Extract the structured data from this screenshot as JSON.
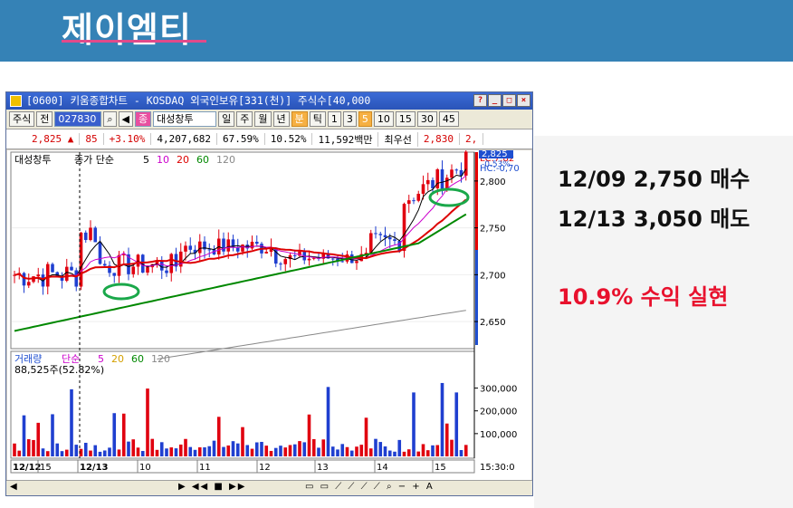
{
  "header": {
    "title": "제이엠티"
  },
  "window": {
    "title": "[0600] 키움종합차트 - KOSDAQ 외국인보유[331(천)] 주식수[40,000",
    "title_buttons": [
      "?",
      "_",
      "□",
      "×"
    ]
  },
  "toolbar": {
    "market": "주식",
    "prev": "전",
    "code": "027830",
    "name_badge": "종",
    "stock_name": "대성창투",
    "periods": [
      "일",
      "주",
      "월",
      "년",
      "분",
      "틱",
      "1",
      "3",
      "5",
      "10",
      "15",
      "30",
      "45"
    ],
    "active_period": "5"
  },
  "quote": {
    "price": "2,825 ▲",
    "change": "85",
    "change_pct": "+3.10%",
    "volume": "4,207,682",
    "ratio1": "67.59%",
    "ratio2": "10.52%",
    "amount": "11,592백만",
    "label_low": "최우선",
    "best": "2,830",
    "extra": "2,"
  },
  "price_legend": {
    "name": "대성창투",
    "series": "종가 단순",
    "ma": [
      "5",
      "10",
      "20",
      "60",
      "120"
    ],
    "ma_colors": [
      "#000000",
      "#cc00cc",
      "#dd0000",
      "#008800",
      "#888888"
    ]
  },
  "price_axis": {
    "hi_box": "LC:7,82",
    "hc_box": "HC:-0,70",
    "current": "2,825",
    "current_pct": "-0.53%",
    "ticks": [
      "2,800",
      "2,750",
      "2,700",
      "2,650"
    ]
  },
  "volume_legend": {
    "name": "거래량",
    "series": "단순",
    "ma": [
      "5",
      "20",
      "60",
      "120"
    ],
    "value": "88,525주(52.82%)"
  },
  "volume_axis": {
    "ticks": [
      "300,000",
      "200,000",
      "100,000"
    ]
  },
  "time_axis": {
    "labels": [
      "12/12",
      "15",
      "12/13",
      "10",
      "11",
      "12",
      "13",
      "14",
      "15",
      "15:30:0"
    ]
  },
  "annotations": {
    "buy": "12/09  2,750  매수",
    "sell": "12/13  3,050  매도",
    "result": "10.9%  수익  실현"
  },
  "chart_data": {
    "type": "candlestick",
    "ylim": [
      2625,
      2825
    ],
    "ma_series": [
      "5",
      "10",
      "20",
      "60",
      "120"
    ],
    "volume_ylim": [
      0,
      350000
    ],
    "last_price": 2825
  }
}
